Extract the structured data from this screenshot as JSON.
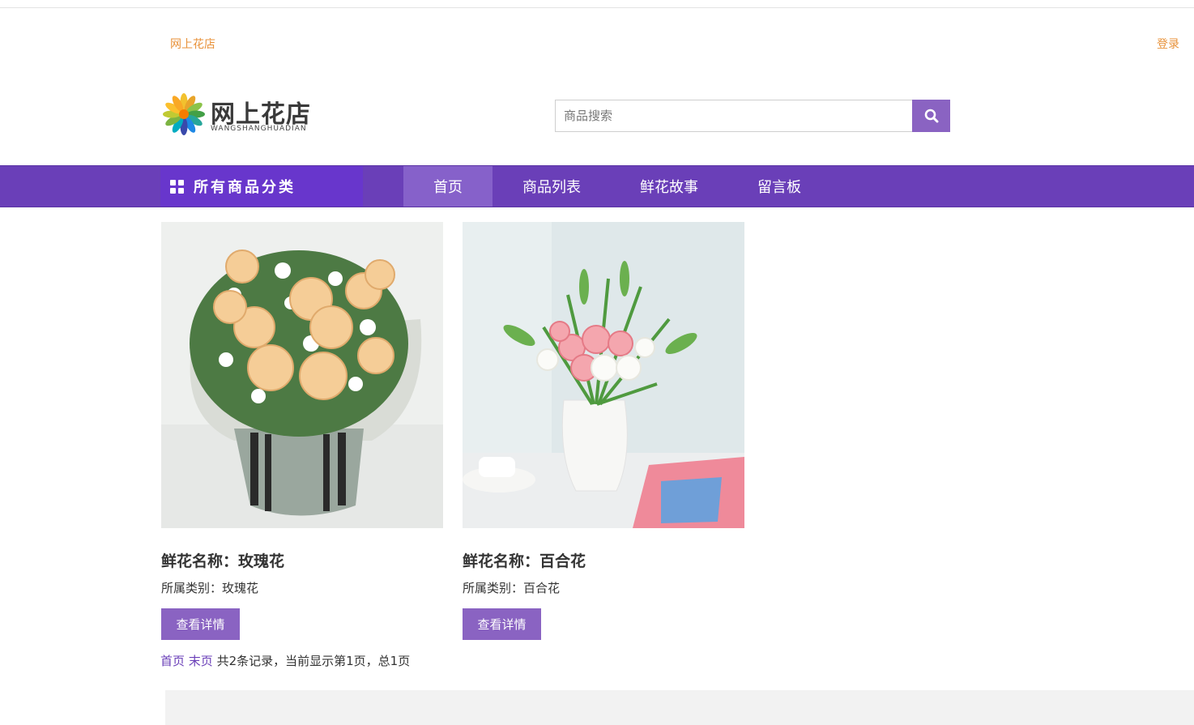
{
  "topbar": {
    "site_link": "网上花店",
    "login": "登录"
  },
  "logo": {
    "title": "网上花店",
    "subtitle": "WANGSHANGHUADIAN",
    "icon": "flower-logo-icon"
  },
  "search": {
    "placeholder": "商品搜索",
    "icon": "search-icon"
  },
  "nav": {
    "category_label": "所有商品分类",
    "category_icon": "grid-icon",
    "items": [
      {
        "label": "首页",
        "active": true
      },
      {
        "label": "商品列表",
        "active": false
      },
      {
        "label": "鲜花故事",
        "active": false
      },
      {
        "label": "留言板",
        "active": false
      }
    ]
  },
  "products": [
    {
      "name": "鲜花名称：玫瑰花",
      "category": "所属类别：玫瑰花",
      "button": "查看详情"
    },
    {
      "name": "鲜花名称：百合花",
      "category": "所属类别：百合花",
      "button": "查看详情"
    }
  ],
  "pagination": {
    "first": "首页",
    "last": "末页",
    "summary": "共2条记录，当前显示第1页，总1页"
  },
  "colors": {
    "accent": "#8a63c2",
    "nav": "#6a3fb8",
    "nav_category": "#6836cc",
    "link_orange": "#e8923a"
  }
}
